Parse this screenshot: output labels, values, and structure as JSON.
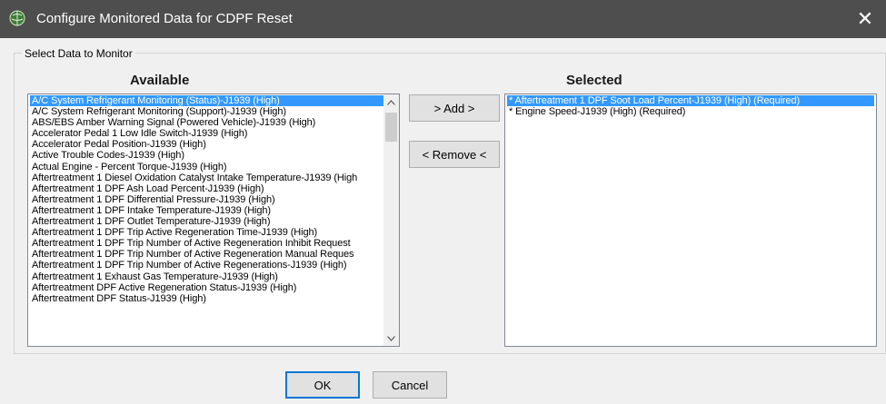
{
  "window": {
    "title": "Configure Monitored Data for CDPF Reset",
    "close_label": "✕"
  },
  "group": {
    "label": "Select Data to Monitor"
  },
  "available": {
    "heading": "Available",
    "items": [
      "A/C System Refrigerant Monitoring (Status)-J1939 (High)",
      "A/C System Refrigerant Monitoring (Support)-J1939 (High)",
      "ABS/EBS Amber Warning Signal (Powered Vehicle)-J1939 (High)",
      "Accelerator Pedal 1 Low Idle Switch-J1939 (High)",
      "Accelerator Pedal Position-J1939 (High)",
      "Active Trouble Codes-J1939 (High)",
      "Actual Engine - Percent Torque-J1939 (High)",
      "Aftertreatment 1 Diesel Oxidation Catalyst Intake Temperature-J1939 (High",
      "Aftertreatment 1 DPF Ash Load Percent-J1939 (High)",
      "Aftertreatment 1 DPF Differential Pressure-J1939 (High)",
      "Aftertreatment 1 DPF Intake Temperature-J1939 (High)",
      "Aftertreatment 1 DPF Outlet Temperature-J1939 (High)",
      "Aftertreatment 1 DPF Trip Active Regeneration Time-J1939 (High)",
      "Aftertreatment 1 DPF Trip Number of Active Regeneration Inhibit Request",
      "Aftertreatment 1 DPF Trip Number of Active Regeneration Manual Reques",
      "Aftertreatment 1 DPF Trip Number of Active Regenerations-J1939 (High)",
      "Aftertreatment 1 Exhaust Gas Temperature-J1939 (High)",
      "Aftertreatment DPF Active Regeneration Status-J1939 (High)",
      "Aftertreatment DPF Status-J1939 (High)"
    ],
    "selected_index": 0
  },
  "selected": {
    "heading": "Selected",
    "items": [
      "* Aftertreatment 1 DPF Soot Load Percent-J1939 (High) (Required)",
      "* Engine Speed-J1939 (High) (Required)"
    ],
    "selected_index": 0
  },
  "buttons": {
    "add": "> Add >",
    "remove": "< Remove <",
    "ok": "OK",
    "cancel": "Cancel"
  },
  "icons": {
    "app": "app-globe-icon",
    "scroll_up": "chevron-up-icon",
    "scroll_down": "chevron-down-icon"
  },
  "colors": {
    "titlebar": "#4e4e4e",
    "selection": "#3399ff",
    "dialog_bg": "#f0f0f0"
  }
}
